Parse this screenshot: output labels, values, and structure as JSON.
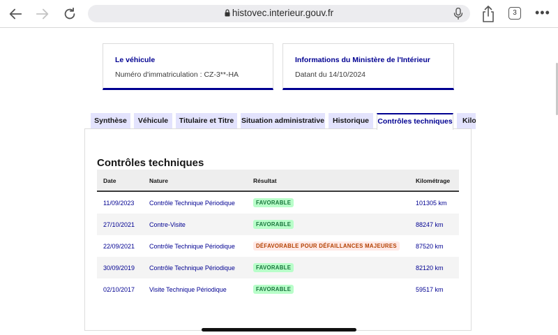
{
  "browser": {
    "url": "histovec.interieur.gouv.fr",
    "tab_count": "3",
    "icons": [
      "back-arrow-icon",
      "forward-arrow-icon",
      "reload-icon",
      "lock-icon",
      "microphone-icon",
      "share-icon",
      "tabs-icon",
      "more-icon"
    ]
  },
  "cards": {
    "vehicle": {
      "title": "Le véhicule",
      "text": "Numéro d'immatriculation : CZ-3**-HA"
    },
    "ministry": {
      "title": "Informations du Ministère de l'Intérieur",
      "text": "Datant du 14/10/2024"
    }
  },
  "tabs": [
    {
      "label": "Synthèse"
    },
    {
      "label": "Véhicule"
    },
    {
      "label": "Titulaire et Titre"
    },
    {
      "label": "Situation administrative"
    },
    {
      "label": "Historique"
    },
    {
      "label": "Contrôles techniques",
      "active": true
    },
    {
      "label": "Kilométrage"
    }
  ],
  "section": {
    "title": "Contrôles techniques"
  },
  "table": {
    "headers": {
      "date": "Date",
      "nature": "Nature",
      "result": "Résultat",
      "mileage": "Kilométrage"
    },
    "rows": [
      {
        "date": "11/09/2023",
        "nature": "Contrôle Technique Périodique",
        "result": "FAVORABLE",
        "status": "ok",
        "mileage": "101305 km"
      },
      {
        "date": "27/10/2021",
        "nature": "Contre-Visite",
        "result": "FAVORABLE",
        "status": "ok",
        "mileage": "88247 km"
      },
      {
        "date": "22/09/2021",
        "nature": "Contrôle Technique Périodique",
        "result": "DÉFAVORABLE POUR DÉFAILLANCES MAJEURES",
        "status": "ko",
        "mileage": "87520 km"
      },
      {
        "date": "30/09/2019",
        "nature": "Contrôle Technique Périodique",
        "result": "FAVORABLE",
        "status": "ok",
        "mileage": "82120 km"
      },
      {
        "date": "02/10/2017",
        "nature": "Visite Technique Périodique",
        "result": "FAVORABLE",
        "status": "ok",
        "mileage": "59517 km"
      }
    ]
  },
  "colors": {
    "accent": "#000091",
    "tab_bg": "#e3e3fd",
    "ok": "#18753c",
    "ok_bg": "#b8fec9",
    "ko": "#b34000",
    "ko_bg": "#ffe9e6"
  }
}
